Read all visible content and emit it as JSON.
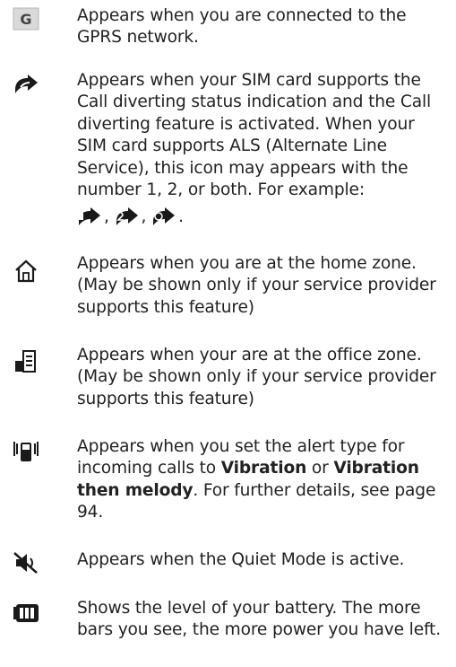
{
  "entries": [
    {
      "icon": "gprs-icon",
      "text": "Appears when you are connected to the GPRS network."
    },
    {
      "icon": "call-divert-icon",
      "text": "Appears when your SIM card supports the Call diverting status indication and the Call diverting feature is activated. When your SIM card supports ALS (Alternate Line Service), this icon may appears with the number 1, 2, or both. For example:",
      "example_sep_1": ",",
      "example_sep_2": ",",
      "example_end": "."
    },
    {
      "icon": "home-zone-icon",
      "text": "Appears when you are at the home zone. (May be shown only if your service provider supports this feature)"
    },
    {
      "icon": "office-zone-icon",
      "text": "Appears when your are at the office zone. (May be shown only if your service provider supports this feature)"
    },
    {
      "icon": "vibration-icon",
      "text_1": "Appears when you set the alert type for incoming calls to",
      "bold_1": "Vibration",
      "text_2": "or",
      "bold_2": "Vibration then melody",
      "text_3": ". For further details, see page 94."
    },
    {
      "icon": "quiet-mode-icon",
      "text": "Appears when the Quiet Mode is active."
    },
    {
      "icon": "battery-icon",
      "text": "Shows the level of your battery. The more bars you see, the more power you have left."
    }
  ]
}
